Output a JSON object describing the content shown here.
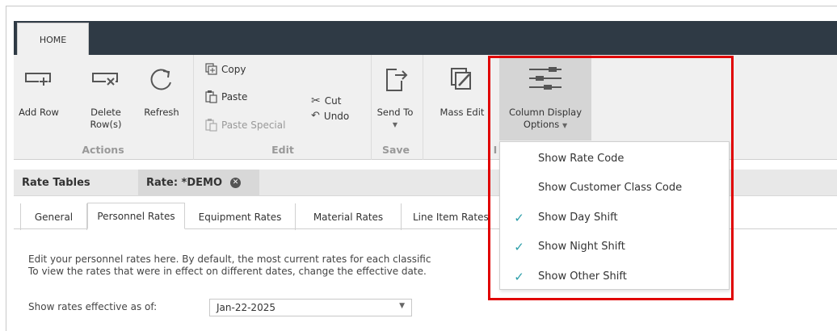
{
  "ribbon": {
    "home_tab": "HOME",
    "actions": {
      "add_row": "Add Row",
      "delete_row_1": "Delete",
      "delete_row_2": "Row(s)",
      "refresh": "Refresh",
      "group": "Actions"
    },
    "edit": {
      "copy": "Copy",
      "paste": "Paste",
      "paste_special": "Paste Special",
      "cut": "Cut",
      "undo": "Undo",
      "group": "Edit"
    },
    "save": {
      "send_to": "Send To",
      "group": "Save"
    },
    "mass_edit": "Mass Edit",
    "column_display_1": "Column Display",
    "column_display_2": "Options",
    "partial_group": "I"
  },
  "doc_tabs": {
    "rate_tables": "Rate Tables",
    "rate_demo": "Rate: *DEMO"
  },
  "sub_tabs": [
    "General",
    "Personnel Rates",
    "Equipment Rates",
    "Material Rates",
    "Line Item Rates"
  ],
  "content": {
    "line1": "Edit your personnel rates here. By default, the most current rates for each classific",
    "line2": "To view the rates that were in effect on different dates, change the effective date.",
    "effective_label": "Show rates effective as of:",
    "effective_value": "Jan-22-2025"
  },
  "dropdown": {
    "items": [
      {
        "label": "Show Rate Code",
        "checked": false
      },
      {
        "label": "Show Customer Class Code",
        "checked": false
      },
      {
        "label": "Show Day Shift",
        "checked": true
      },
      {
        "label": "Show Night Shift",
        "checked": true
      },
      {
        "label": "Show Other Shift",
        "checked": true
      }
    ]
  },
  "colors": {
    "accent_check": "#2a9da8",
    "highlight": "#e00000",
    "tabstrip": "#2f3a45"
  }
}
